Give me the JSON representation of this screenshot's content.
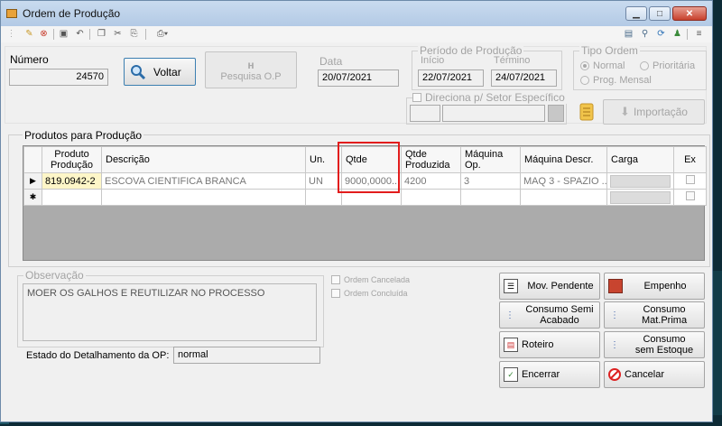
{
  "window": {
    "title": "Ordem de Produção"
  },
  "numero": {
    "label": "Número",
    "value": "24570"
  },
  "buttons": {
    "voltar": "Voltar",
    "pesquisa": "Pesquisa O.P",
    "importacao": "Importação"
  },
  "data": {
    "label": "Data",
    "value": "20/07/2021"
  },
  "periodo": {
    "label": "Período de Produção",
    "inicio_label": "Início",
    "inicio": "22/07/2021",
    "termino_label": "Término",
    "termino": "24/07/2021"
  },
  "tipo": {
    "label": "Tipo Ordem",
    "options": [
      "Normal",
      "Prioritária",
      "Prog. Mensal"
    ]
  },
  "direciona": {
    "label": "Direciona p/ Setor Específico"
  },
  "produtos": {
    "label": "Produtos para Produção",
    "columns": [
      "Produto Produção",
      "Descrição",
      "Un.",
      "Qtde",
      "Qtde Produzida",
      "Máquina Op.",
      "Máquina Descr.",
      "Carga",
      "Ex"
    ],
    "rows": [
      {
        "produto": "819.0942-2",
        "descricao": "ESCOVA CIENTIFICA BRANCA",
        "un": "UN",
        "qtde": "9000,0000...",
        "qtde_produzida": "4200",
        "maquina_op": "3",
        "maquina_descr": "MAQ 3 - SPAZIO ..."
      }
    ]
  },
  "observacao": {
    "label": "Observação",
    "value": "MOER OS GALHOS E REUTILIZAR NO PROCESSO"
  },
  "checks": {
    "cancelada": "Ordem Cancelada",
    "concluida": "Ordem Concluída"
  },
  "estado": {
    "label": "Estado do Detalhamento da OP:",
    "value": "normal"
  },
  "actions": {
    "mov_pendente": "Mov. Pendente",
    "empenho": "Empenho",
    "consumo_semi_1": "Consumo Semi",
    "consumo_semi_2": "Acabado",
    "consumo_mat_1": "Consumo",
    "consumo_mat_2": "Mat.Prima",
    "roteiro": "Roteiro",
    "consumo_sem_1": "Consumo",
    "consumo_sem_2": "sem Estoque",
    "encerrar": "Encerrar",
    "cancelar": "Cancelar"
  },
  "colors": {
    "highlight": "#e21c1c",
    "titlebar": "#c9dbef",
    "close": "#c7402c"
  }
}
